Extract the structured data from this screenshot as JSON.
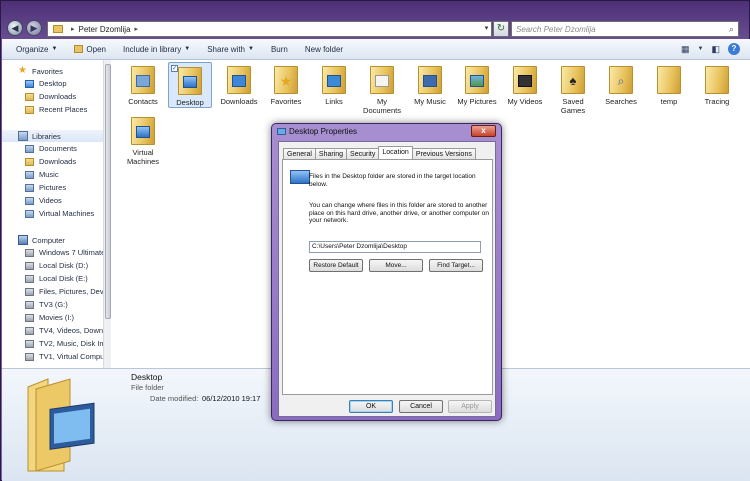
{
  "address": {
    "crumb": "Peter Dzomlija",
    "search_placeholder": "Search Peter Dzomlija"
  },
  "toolbar": {
    "organize": "Organize",
    "open": "Open",
    "include_in_library": "Include in library",
    "share_with": "Share with",
    "burn": "Burn",
    "new_folder": "New folder"
  },
  "nav": {
    "favorites": "Favorites",
    "favorites_items": [
      "Desktop",
      "Downloads",
      "Recent Places"
    ],
    "libraries": "Libraries",
    "libraries_items": [
      "Documents",
      "Downloads",
      "Music",
      "Pictures",
      "Videos",
      "Virtual Machines"
    ],
    "computer": "Computer",
    "computer_items": [
      "Windows 7 Ultimate",
      "Local Disk (D:)",
      "Local Disk (E:)",
      "Files, Pictures, Dev I",
      "TV3 (G:)",
      "Movies (I:)",
      "TV4, Videos, Downlo",
      "TV2, Music, Disk Im",
      "TV1, Virtual Compu"
    ]
  },
  "folders": [
    {
      "name": "Contacts",
      "badge": "contacts"
    },
    {
      "name": "Desktop",
      "badge": "desktop",
      "selected": true
    },
    {
      "name": "Downloads",
      "badge": "downloads"
    },
    {
      "name": "Favorites",
      "badge": "star"
    },
    {
      "name": "Links",
      "badge": "links"
    },
    {
      "name": "My Documents",
      "badge": "documents"
    },
    {
      "name": "My Music",
      "badge": "music"
    },
    {
      "name": "My Pictures",
      "badge": "pictures"
    },
    {
      "name": "My Videos",
      "badge": "videos"
    },
    {
      "name": "Saved Games",
      "badge": "games"
    },
    {
      "name": "Searches",
      "badge": "search"
    },
    {
      "name": "temp",
      "badge": "none"
    },
    {
      "name": "Tracing",
      "badge": "none"
    },
    {
      "name": "Virtual Machines",
      "badge": "vm"
    }
  ],
  "details": {
    "name": "Desktop",
    "type": "File folder",
    "modified_label": "Date modified:",
    "modified_value": "06/12/2010 19:17"
  },
  "dialog": {
    "title": "Desktop Properties",
    "close": "x",
    "tabs": [
      "General",
      "Sharing",
      "Security",
      "Location",
      "Previous Versions"
    ],
    "active_tab": "Location",
    "text1": "Files in the Desktop folder are stored in the target location below.",
    "text2": "You can change where files in this folder are stored to another place on this hard drive, another drive, or another computer on your network.",
    "path": "C:\\Users\\Peter Dzomlija\\Desktop",
    "restore_default": "Restore Default",
    "move": "Move...",
    "find_target": "Find Target...",
    "ok": "OK",
    "cancel": "Cancel",
    "apply": "Apply"
  }
}
